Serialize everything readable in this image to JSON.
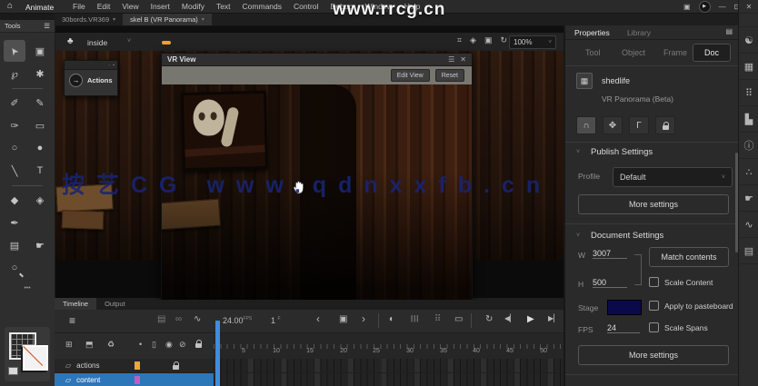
{
  "colors": {
    "accent_blue": "#2d76b8",
    "playhead_blue": "#3e8ede",
    "orange_marker": "#f0a030",
    "layer_actions_swatch": "#f0a43c",
    "layer_content_swatch": "#c45ac4",
    "stage_swatch": "#0a0a4a"
  },
  "watermarks": {
    "top": "www.rrcg.cn",
    "middle": "按艺CG www.qdnxxfb.cn"
  },
  "menubar": {
    "app_label": "Animate",
    "menus": [
      "File",
      "Edit",
      "View",
      "Insert",
      "Modify",
      "Text",
      "Commands",
      "Control",
      "Debug",
      "Window",
      "Help"
    ]
  },
  "doc_tabs": {
    "tab1": "30bords.VR369",
    "tab2": "skel B (VR Panorama)"
  },
  "tools_panel": {
    "title": "Tools",
    "tools": [
      {
        "name": "selection",
        "glyph": "➤"
      },
      {
        "name": "free-transform",
        "glyph": "▣"
      },
      {
        "name": "lasso",
        "glyph": "℘"
      },
      {
        "name": "asset-warp",
        "glyph": "✱"
      },
      {
        "name": "fluid-brush",
        "glyph": "✐"
      },
      {
        "name": "classic-brush",
        "glyph": "✎"
      },
      {
        "name": "pencil",
        "glyph": "✑"
      },
      {
        "name": "rectangle",
        "glyph": "▭"
      },
      {
        "name": "oval",
        "glyph": "○"
      },
      {
        "name": "oval-filled",
        "glyph": "●"
      },
      {
        "name": "line",
        "glyph": "╲"
      },
      {
        "name": "text",
        "glyph": "T"
      },
      {
        "name": "eraser",
        "glyph": "◆"
      },
      {
        "name": "paint-bucket",
        "glyph": "◈"
      },
      {
        "name": "pen",
        "glyph": "✒"
      },
      {
        "name": "camera",
        "glyph": "▤"
      },
      {
        "name": "hand",
        "glyph": "☛"
      },
      {
        "name": "zoom",
        "glyph": "○"
      }
    ],
    "ellipsis": "•••"
  },
  "edit_bar": {
    "symbol_name": "inside",
    "zoom_value": "100%"
  },
  "actions_popup": {
    "label": "Actions"
  },
  "vr_view": {
    "title": "VR View",
    "buttons": {
      "edit_view": "Edit View",
      "reset": "Reset"
    }
  },
  "timeline": {
    "tab_timeline": "Timeline",
    "tab_output": "Output",
    "fps_value": "24.00",
    "fps_unit": "FPS",
    "frame_value": "1",
    "frame_unit": "F",
    "ruler": [
      "5",
      "10",
      "15",
      "20",
      "25",
      "30",
      "35",
      "40",
      "45",
      "50"
    ],
    "layers": [
      {
        "name": "actions"
      },
      {
        "name": "content"
      }
    ]
  },
  "properties": {
    "tab_properties": "Properties",
    "tab_library": "Library",
    "subtab_tool": "Tool",
    "subtab_object": "Object",
    "subtab_frame": "Frame",
    "subtab_doc": "Doc",
    "doc_name": "shedlife",
    "doc_type": "VR Panorama (Beta)",
    "publish": {
      "title": "Publish Settings",
      "profile_label": "Profile",
      "profile_value": "Default",
      "more_settings": "More settings"
    },
    "document": {
      "title": "Document Settings",
      "w_label": "W",
      "w_value": "3007",
      "h_label": "H",
      "h_value": "500",
      "stage_label": "Stage",
      "fps_label": "FPS",
      "fps_value": "24",
      "match_contents": "Match contents",
      "scale_content": "Scale Content",
      "apply_to_pasteboard": "Apply to pasteboard",
      "scale_spans": "Scale Spans",
      "more_settings": "More settings"
    }
  },
  "icons": {
    "home": "⌂",
    "hamburger": "☰",
    "chevron_down": "˅",
    "chevron_small": "▾",
    "workspace": "▣",
    "play_record": "▶",
    "minimize": "—",
    "restore": "⊡",
    "close": "✕",
    "scene": "♣",
    "grid": "⌗",
    "snap": "◈",
    "clip": "▣",
    "rotate": "↻",
    "props_menu": "▤",
    "layers_stack": "≡",
    "camera": "▤",
    "link": "∞",
    "graph": "∿",
    "prev_frame": "‹",
    "center_frame": "▣",
    "next_frame": "›",
    "loop_half": "◐",
    "onion_bars": "|||",
    "dots_grid": "⠿",
    "screen_outline": "▭",
    "loop": "↻",
    "step_back": "◀▏",
    "play": "▶",
    "step_forward": "▶▏",
    "new_layer": "⊞",
    "new_folder": "⬒",
    "delete_layer": "♻",
    "dot": "•",
    "outline_square": "▯",
    "show_all": "◉",
    "hide_all": "⊘",
    "page": "▱",
    "doc_icon": "▦",
    "orbit": "∩",
    "pan": "✥",
    "corner_ruler": "Γ",
    "actions_arrow": "→"
  },
  "dock": {
    "items": [
      {
        "name": "color-panel",
        "glyph": "☯"
      },
      {
        "name": "swatches-panel",
        "glyph": "▦"
      },
      {
        "name": "fragments-panel",
        "glyph": "⠿"
      },
      {
        "name": "align-panel",
        "glyph": "▙"
      },
      {
        "name": "info-panel",
        "glyph": "ⓘ"
      },
      {
        "name": "particles-panel",
        "glyph": "∴"
      },
      {
        "name": "gesture-panel",
        "glyph": "☛"
      },
      {
        "name": "history-panel",
        "glyph": "∿"
      },
      {
        "name": "libraries-panel",
        "glyph": "▤"
      }
    ]
  }
}
